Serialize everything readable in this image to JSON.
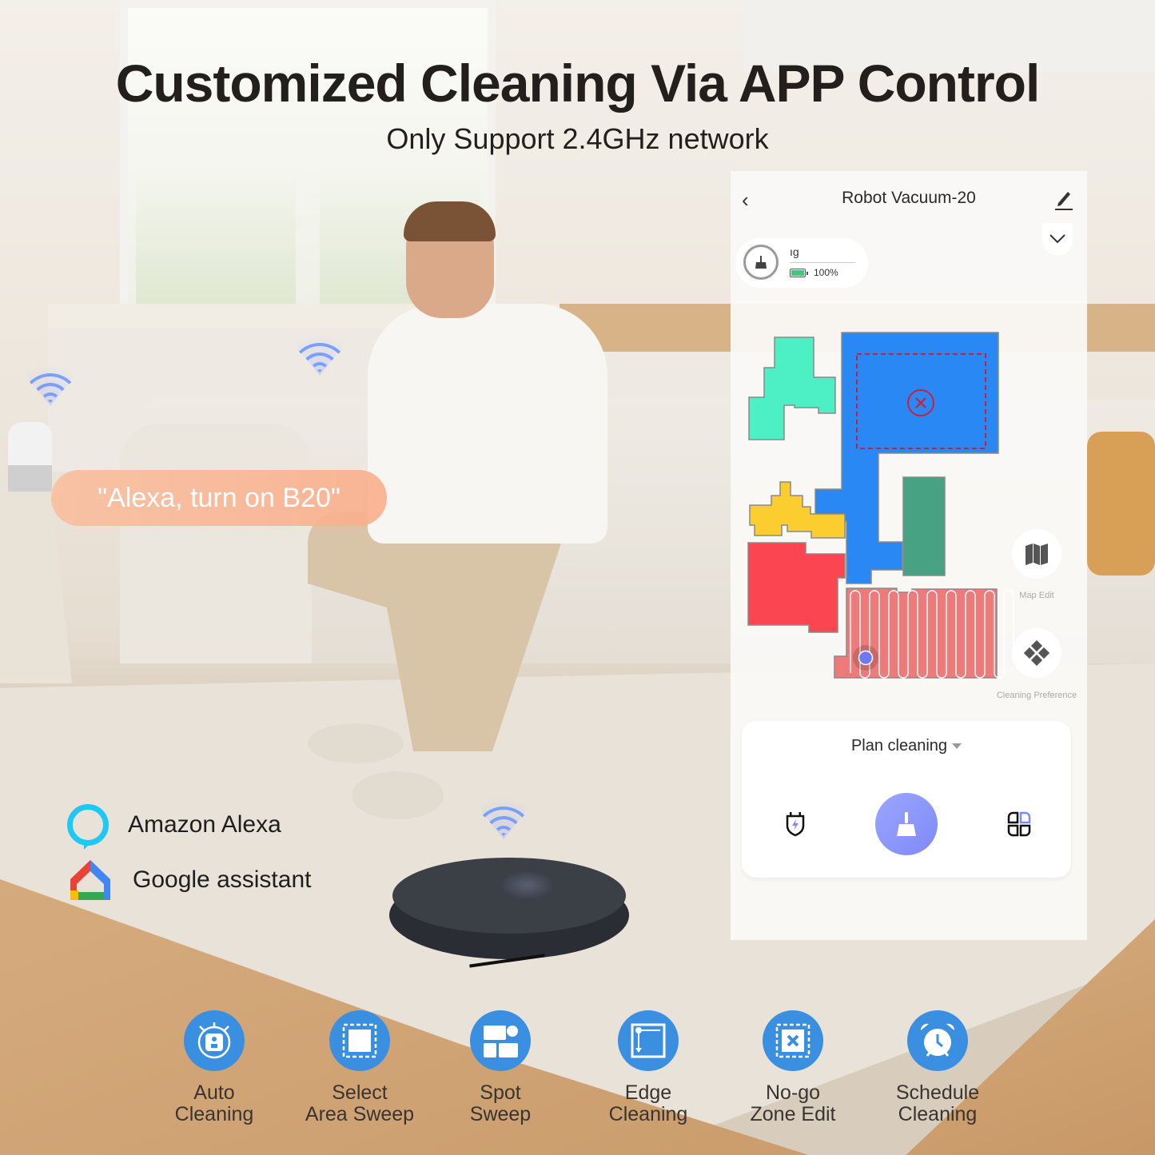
{
  "headline": {
    "title": "Customized Cleaning Via APP Control",
    "subtitle": "Only Support 2.4GHz network"
  },
  "voice_command": "\"Alexa, turn on B20\"",
  "assistants": [
    {
      "name": "Amazon Alexa",
      "icon": "alexa-icon"
    },
    {
      "name": "Google assistant",
      "icon": "google-home-icon"
    }
  ],
  "app": {
    "title": "Robot Vacuum-20",
    "back_icon": "chevron-left-icon",
    "edit_icon": "pencil-icon",
    "collapse_icon": "chevron-down-icon",
    "status": {
      "mode_text": "ıg",
      "battery_percent": "100%",
      "battery_level": 1.0,
      "battery_color": "#4cc27a"
    },
    "map": {
      "rooms": [
        {
          "name": "room-teal",
          "color": "#4df0c4"
        },
        {
          "name": "room-blue",
          "color": "#2a88f4"
        },
        {
          "name": "room-yellow",
          "color": "#fbcd2e"
        },
        {
          "name": "room-red",
          "color": "#fb4651"
        },
        {
          "name": "room-green",
          "color": "#47a283"
        },
        {
          "name": "room-pink-cleaning",
          "color": "#ee7a79"
        }
      ],
      "no_go_zone_color": "#c8203a",
      "robot_marker_color": "#6f78f0"
    },
    "side_buttons": [
      {
        "label": "Map Edit",
        "icon": "map-icon"
      },
      {
        "label": "Cleaning Preference",
        "icon": "preference-icon"
      }
    ],
    "plan_card": {
      "mode_label": "Plan cleaning",
      "dock_icon": "charge-dock-icon",
      "start_icon": "broom-icon",
      "rooms_icon": "room-select-icon",
      "accent": "#8791f8"
    }
  },
  "features": [
    {
      "label_line1": "Auto",
      "label_line2": "Cleaning",
      "icon": "auto-cleaning-icon"
    },
    {
      "label_line1": "Select",
      "label_line2": "Area Sweep",
      "icon": "select-area-icon"
    },
    {
      "label_line1": "Spot",
      "label_line2": "Sweep",
      "icon": "spot-sweep-icon"
    },
    {
      "label_line1": "Edge",
      "label_line2": "Cleaning",
      "icon": "edge-cleaning-icon"
    },
    {
      "label_line1": "No-go",
      "label_line2": "Zone Edit",
      "icon": "no-go-zone-icon"
    },
    {
      "label_line1": "Schedule",
      "label_line2": "Cleaning",
      "icon": "schedule-icon"
    }
  ],
  "feature_icon_color": "#3b8fe0"
}
